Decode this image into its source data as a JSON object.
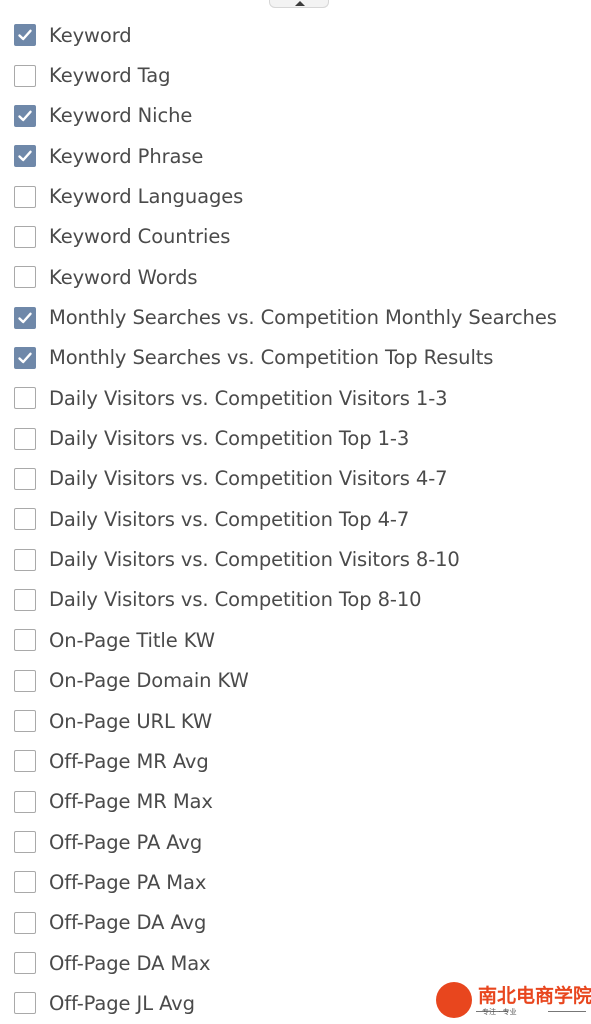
{
  "panel": {
    "collapse_icon": "caret-up-icon",
    "items": [
      {
        "label": "Keyword",
        "checked": true
      },
      {
        "label": "Keyword Tag",
        "checked": false
      },
      {
        "label": "Keyword Niche",
        "checked": true
      },
      {
        "label": "Keyword Phrase",
        "checked": true
      },
      {
        "label": "Keyword Languages",
        "checked": false
      },
      {
        "label": "Keyword Countries",
        "checked": false
      },
      {
        "label": "Keyword Words",
        "checked": false
      },
      {
        "label": "Monthly Searches vs. Competition Monthly Searches",
        "checked": true
      },
      {
        "label": "Monthly Searches vs. Competition Top Results",
        "checked": true
      },
      {
        "label": "Daily Visitors vs. Competition Visitors 1-3",
        "checked": false
      },
      {
        "label": "Daily Visitors vs. Competition Top 1-3",
        "checked": false
      },
      {
        "label": "Daily Visitors vs. Competition Visitors 4-7",
        "checked": false
      },
      {
        "label": "Daily Visitors vs. Competition Top 4-7",
        "checked": false
      },
      {
        "label": "Daily Visitors vs. Competition Visitors 8-10",
        "checked": false
      },
      {
        "label": "Daily Visitors vs. Competition Top 8-10",
        "checked": false
      },
      {
        "label": "On-Page Title KW",
        "checked": false
      },
      {
        "label": "On-Page Domain KW",
        "checked": false
      },
      {
        "label": "On-Page URL KW",
        "checked": false
      },
      {
        "label": "Off-Page MR Avg",
        "checked": false
      },
      {
        "label": "Off-Page MR Max",
        "checked": false
      },
      {
        "label": "Off-Page PA Avg",
        "checked": false
      },
      {
        "label": "Off-Page PA Max",
        "checked": false
      },
      {
        "label": "Off-Page DA Avg",
        "checked": false
      },
      {
        "label": "Off-Page DA Max",
        "checked": false
      },
      {
        "label": "Off-Page JL Avg",
        "checked": false
      }
    ]
  },
  "colors": {
    "checked_fill": "#6f88a9",
    "unchecked_border": "#a9a9a9",
    "label_text": "#4a4a4a",
    "watermark": "#e8461e"
  },
  "watermark": {
    "title": "南北电商学院",
    "subtitle": "专注 · 专业"
  }
}
